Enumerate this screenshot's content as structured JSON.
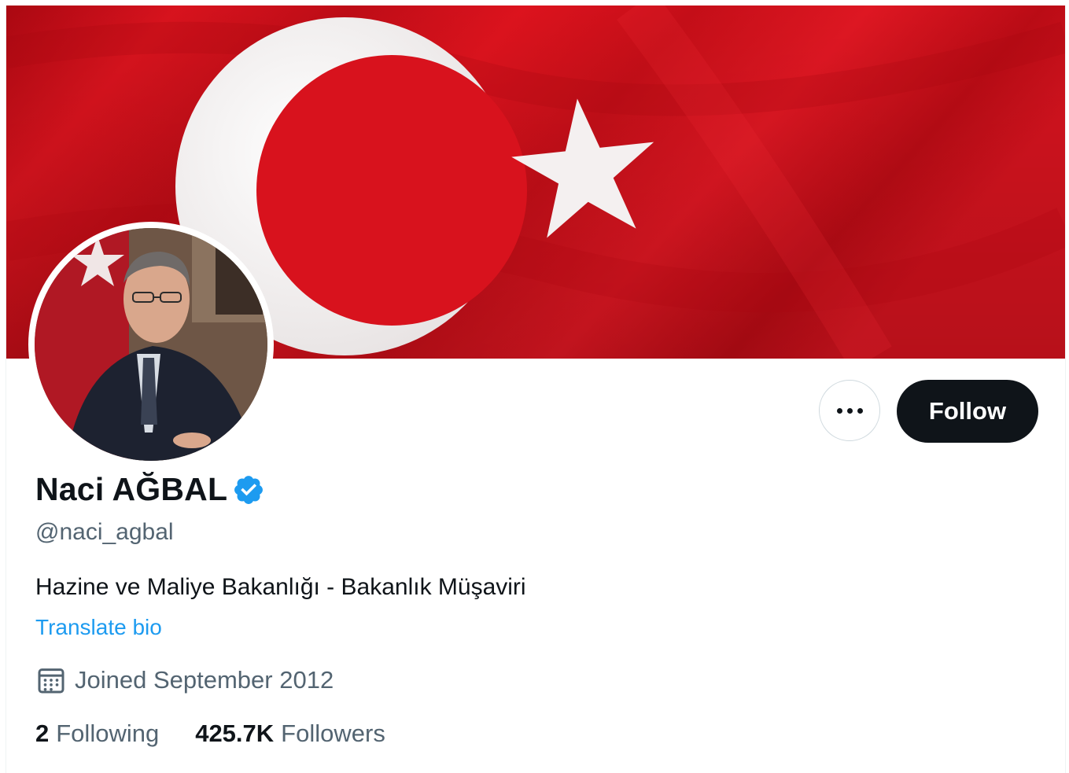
{
  "profile": {
    "display_name": "Naci AĞBAL",
    "handle": "@naci_agbal",
    "bio": "Hazine ve Maliye Bakanlığı - Bakanlık Müşaviri",
    "translate_bio_label": "Translate bio",
    "joined_text": "Joined September 2012",
    "verified": true
  },
  "actions": {
    "more_icon": "more-horizontal-icon",
    "follow_label": "Follow"
  },
  "stats": {
    "following_count": "2",
    "following_label": "Following",
    "followers_count": "425.7K",
    "followers_label": "Followers"
  },
  "icons": {
    "verified": "verified-badge-icon",
    "calendar": "calendar-icon"
  },
  "colors": {
    "accent": "#1d9bf0",
    "primary_text": "#0f1419",
    "secondary_text": "#536471",
    "flag_red": "#d0111b"
  }
}
